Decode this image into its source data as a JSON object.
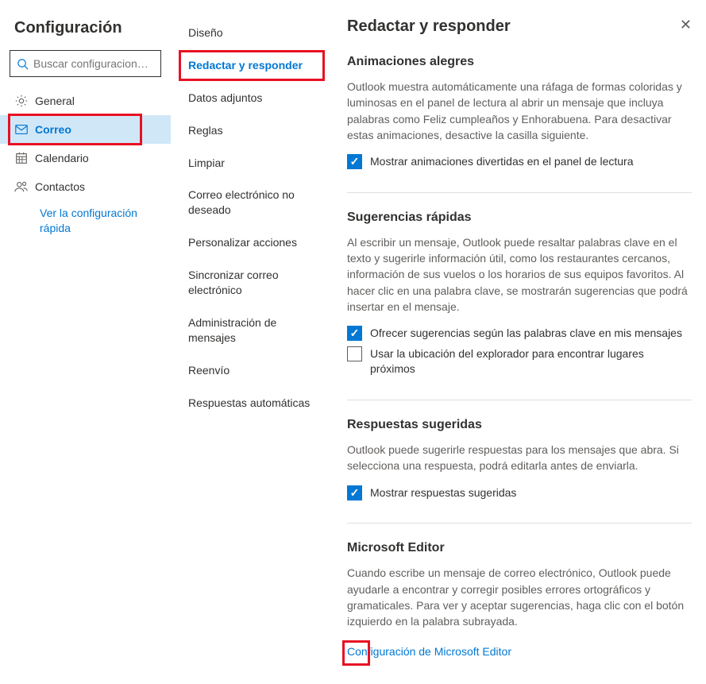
{
  "nav": {
    "title": "Configuración",
    "searchPlaceholder": "Buscar configuracion…",
    "items": [
      {
        "label": "General"
      },
      {
        "label": "Correo",
        "selected": true
      },
      {
        "label": "Calendario"
      },
      {
        "label": "Contactos"
      }
    ],
    "quickLink": "Ver la configuración rápida"
  },
  "sub": {
    "items": [
      {
        "label": "Diseño"
      },
      {
        "label": "Redactar y responder",
        "active": true
      },
      {
        "label": "Datos adjuntos"
      },
      {
        "label": "Reglas"
      },
      {
        "label": "Limpiar"
      },
      {
        "label": "Correo electrónico no deseado"
      },
      {
        "label": "Personalizar acciones"
      },
      {
        "label": "Sincronizar correo electrónico"
      },
      {
        "label": "Administración de mensajes"
      },
      {
        "label": "Reenvío"
      },
      {
        "label": "Respuestas automáticas"
      }
    ]
  },
  "content": {
    "title": "Redactar y responder",
    "sections": {
      "anim": {
        "h": "Animaciones alegres",
        "p": "Outlook muestra automáticamente una ráfaga de formas coloridas y luminosas en el panel de lectura al abrir un mensaje que incluya palabras como Feliz cumpleaños y Enhorabuena. Para desactivar estas animaciones, desactive la casilla siguiente.",
        "chk1": "Mostrar animaciones divertidas en el panel de lectura"
      },
      "quick": {
        "h": "Sugerencias rápidas",
        "p": "Al escribir un mensaje, Outlook puede resaltar palabras clave en el texto y sugerirle información útil, como los restaurantes cercanos, información de sus vuelos o los horarios de sus equipos favoritos. Al hacer clic en una palabra clave, se mostrarán sugerencias que podrá insertar en el mensaje.",
        "chk1": "Ofrecer sugerencias según las palabras clave en mis mensajes",
        "chk2": "Usar la ubicación del explorador para encontrar lugares próximos"
      },
      "replies": {
        "h": "Respuestas sugeridas",
        "p": "Outlook puede sugerirle respuestas para los mensajes que abra. Si selecciona una respuesta, podrá editarla antes de enviarla.",
        "chk1": "Mostrar respuestas sugeridas"
      },
      "editor": {
        "h": "Microsoft Editor",
        "p": "Cuando escribe un mensaje de correo electrónico, Outlook puede ayudarle a encontrar y corregir posibles errores ortográficos y gramaticales. Para ver y aceptar sugerencias, haga clic con el botón izquierdo en la palabra subrayada.",
        "link": "Configuración de Microsoft Editor"
      }
    }
  }
}
